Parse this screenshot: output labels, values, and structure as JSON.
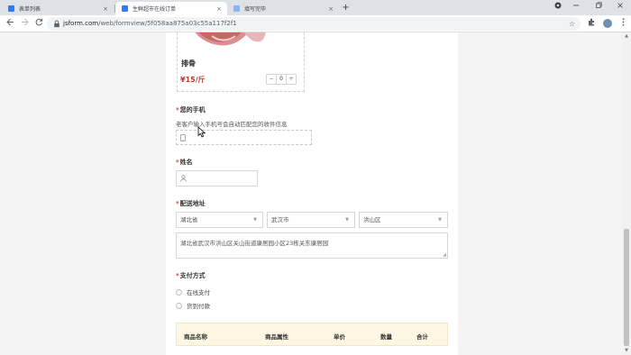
{
  "browser": {
    "tabs": [
      {
        "label": "表单列表",
        "favicon_color": "#2f7cf6",
        "active": false
      },
      {
        "label": "生鲜超市在线订单",
        "favicon_color": "#2f7cf6",
        "active": true
      },
      {
        "label": "填写完毕",
        "favicon_color": "#8ab4f8",
        "active": false
      }
    ],
    "close_glyph": "×",
    "new_tab_glyph": "+",
    "url_host": "jsform.com",
    "url_path": "/web/formview/5f058aa875a03c55a117f2f1",
    "icons": [
      "back-icon",
      "forward-icon",
      "reload-icon",
      "lock-icon",
      "star-icon",
      "extensions-icon",
      "menu-icon",
      "minimize-icon",
      "maximize-icon",
      "close-icon"
    ]
  },
  "product": {
    "name": "排骨",
    "price": "¥15/斤",
    "quantity": "0",
    "minus": "−",
    "plus": "+"
  },
  "form": {
    "phone": {
      "label": "您的手机",
      "hint": "老客户输入手机号会自动匹配您的收件信息",
      "value": ""
    },
    "name": {
      "label": "姓名",
      "value": ""
    },
    "address": {
      "label": "配送地址",
      "province": "湖北省",
      "city": "武汉市",
      "district": "洪山区",
      "detail": "湖北省武汉市洪山区关山街道康居园小区23栋关东康居园"
    },
    "payment": {
      "label": "支付方式",
      "options": [
        "在线支付",
        "货到付款"
      ]
    },
    "required_mark": "*",
    "order_table": {
      "headers": [
        "商品名称",
        "商品属性",
        "单价",
        "数量",
        "合计"
      ]
    }
  },
  "colors": {
    "price_red": "#c0392b",
    "required_red": "#e03e2d",
    "table_header_bg": "#fdf6e3",
    "page_bg": "#f4f4f5"
  }
}
